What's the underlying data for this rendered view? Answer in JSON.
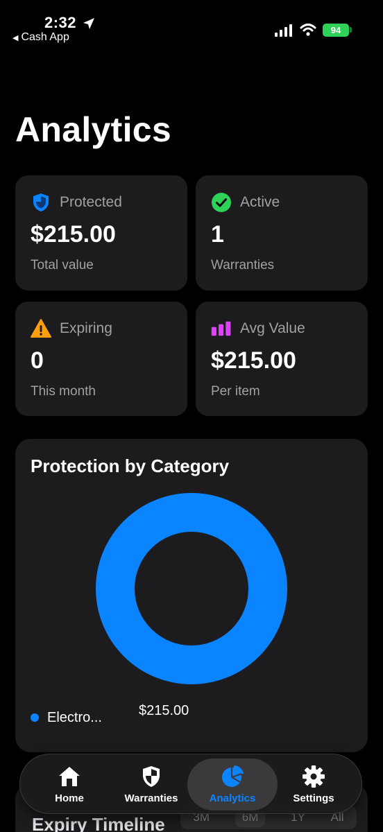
{
  "status_bar": {
    "time": "2:32",
    "back_app": "Cash App",
    "battery": "94"
  },
  "page": {
    "title": "Analytics"
  },
  "cards": {
    "protected": {
      "label": "Protected",
      "value": "$215.00",
      "sub": "Total value"
    },
    "active": {
      "label": "Active",
      "value": "1",
      "sub": "Warranties"
    },
    "expiring": {
      "label": "Expiring",
      "value": "0",
      "sub": "This month"
    },
    "avg": {
      "label": "Avg Value",
      "value": "$215.00",
      "sub": "Per item"
    }
  },
  "category": {
    "title": "Protection by Category",
    "legend": [
      {
        "name": "Electro...",
        "value": "$215.00",
        "color": "#0a84ff"
      }
    ]
  },
  "chart_data": {
    "type": "pie",
    "title": "Protection by Category",
    "categories": [
      "Electro..."
    ],
    "values": [
      215.0
    ]
  },
  "timeline": {
    "title": "Expiry Timeline",
    "ranges": [
      "3M",
      "6M",
      "1Y",
      "All"
    ],
    "selected": "6M"
  },
  "tab_bar": {
    "tabs": [
      {
        "label": "Home",
        "icon": "house-icon"
      },
      {
        "label": "Warranties",
        "icon": "shield-icon"
      },
      {
        "label": "Analytics",
        "icon": "pie-chart-icon"
      },
      {
        "label": "Settings",
        "icon": "gear-icon"
      }
    ],
    "active": "Analytics"
  },
  "colors": {
    "accent": "#0a84ff",
    "success": "#30d158",
    "warning": "#ff9f0a",
    "magenta": "#bf5af2",
    "card_bg": "#1c1c1e"
  }
}
